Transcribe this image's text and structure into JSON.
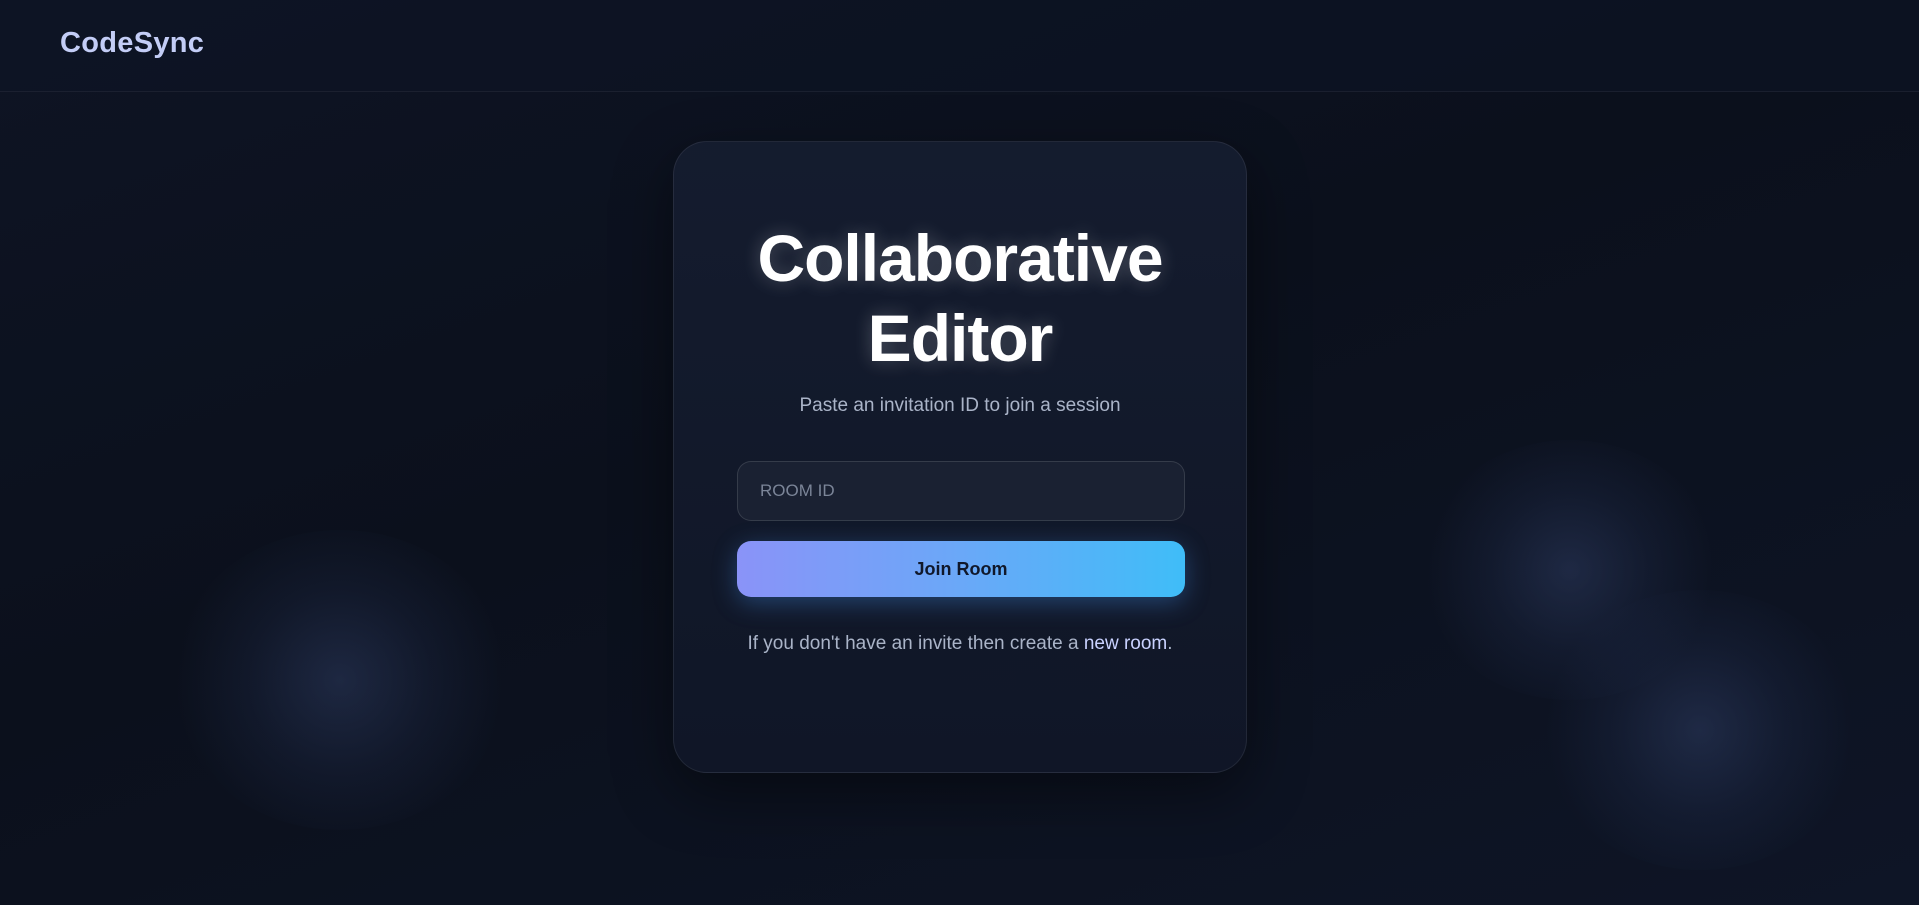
{
  "header": {
    "logo": "CodeSync"
  },
  "card": {
    "title_line1": "Collaborative",
    "title_line2": "Editor",
    "subtitle": "Paste an invitation ID to join a session",
    "room_input": {
      "placeholder": "ROOM ID",
      "value": ""
    },
    "join_button_label": "Join Room",
    "invite_prefix": "If you don't have an invite then create a ",
    "new_room_link": "new room",
    "invite_suffix": "."
  },
  "colors": {
    "background": "#0e1424",
    "logo": "#c3cdf6",
    "button_gradient_start": "#8a93f8",
    "button_gradient_end": "#3fbdf8",
    "link": "#c9d2ff"
  }
}
